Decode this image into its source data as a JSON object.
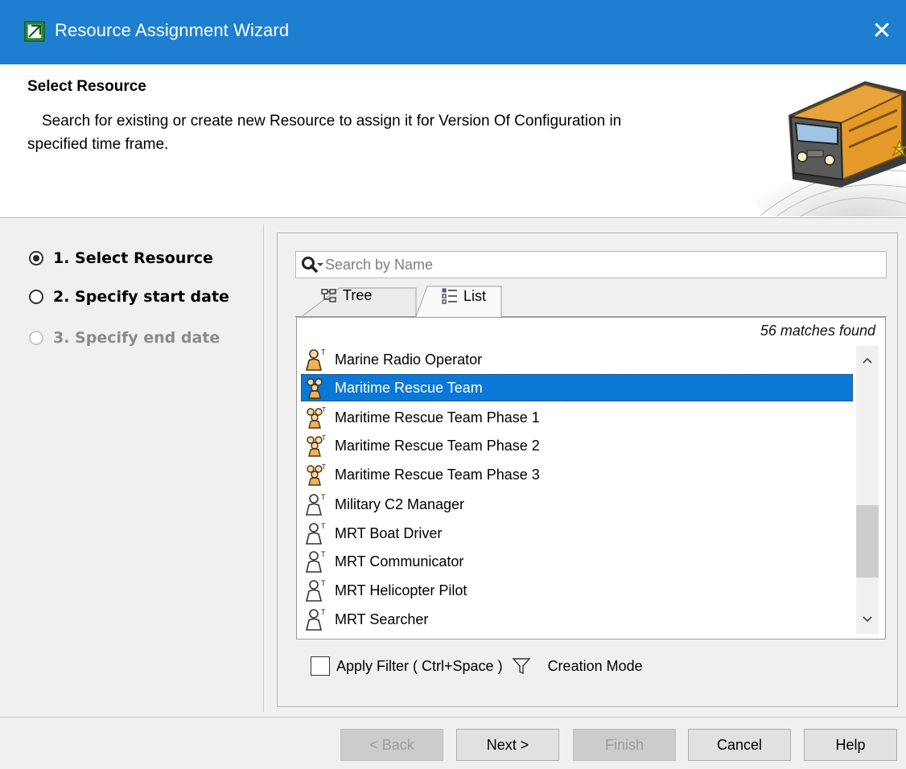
{
  "window": {
    "title": "Resource Assignment Wizard",
    "close_glyph": "✕",
    "titlebar_color": "#1e7fd0"
  },
  "header": {
    "title": "Select Resource",
    "description_line1": "Search for existing or create new Resource to assign it for Version Of Configuration in",
    "description_line2": "specified time frame.",
    "illustration": "train-icon"
  },
  "steps": [
    {
      "label": "1. Select Resource",
      "state": "checked"
    },
    {
      "label": "2. Specify start date",
      "state": "unchecked"
    },
    {
      "label": "3. Specify end date",
      "state": "disabled"
    }
  ],
  "search": {
    "placeholder": "Search by Name",
    "value": ""
  },
  "tabs": [
    {
      "label": "Tree",
      "icon": "tree-icon",
      "active": false
    },
    {
      "label": "List",
      "icon": "list-icon",
      "active": true
    }
  ],
  "matches_text": "56 matches found",
  "selected_color": "#0a78d7",
  "items": [
    {
      "label": "Marine Radio Operator",
      "icon": "person-role-icon",
      "colored": true,
      "selected": false
    },
    {
      "label": "Maritime Rescue Team",
      "icon": "team-icon",
      "colored": true,
      "selected": true
    },
    {
      "label": "Maritime Rescue Team Phase 1",
      "icon": "team-icon",
      "colored": true,
      "selected": false
    },
    {
      "label": "Maritime Rescue Team Phase 2",
      "icon": "team-icon",
      "colored": true,
      "selected": false
    },
    {
      "label": "Maritime Rescue Team Phase 3",
      "icon": "team-icon",
      "colored": true,
      "selected": false
    },
    {
      "label": "Military C2 Manager",
      "icon": "person-role-icon",
      "colored": false,
      "selected": false
    },
    {
      "label": "MRT Boat Driver",
      "icon": "person-role-icon",
      "colored": false,
      "selected": false
    },
    {
      "label": "MRT Communicator",
      "icon": "person-role-icon",
      "colored": false,
      "selected": false
    },
    {
      "label": "MRT Helicopter Pilot",
      "icon": "person-role-icon",
      "colored": false,
      "selected": false
    },
    {
      "label": "MRT Searcher",
      "icon": "person-role-icon",
      "colored": false,
      "selected": false
    }
  ],
  "filter": {
    "checkbox_label": "Apply Filter ( Ctrl+Space )",
    "checked": false,
    "creation_mode_label": "Creation Mode"
  },
  "buttons": {
    "back": {
      "label": "< Back",
      "enabled": false
    },
    "next": {
      "label": "Next >",
      "enabled": true
    },
    "finish": {
      "label": "Finish",
      "enabled": false
    },
    "cancel": {
      "label": "Cancel",
      "enabled": true
    },
    "help": {
      "label": "Help",
      "enabled": true
    }
  }
}
